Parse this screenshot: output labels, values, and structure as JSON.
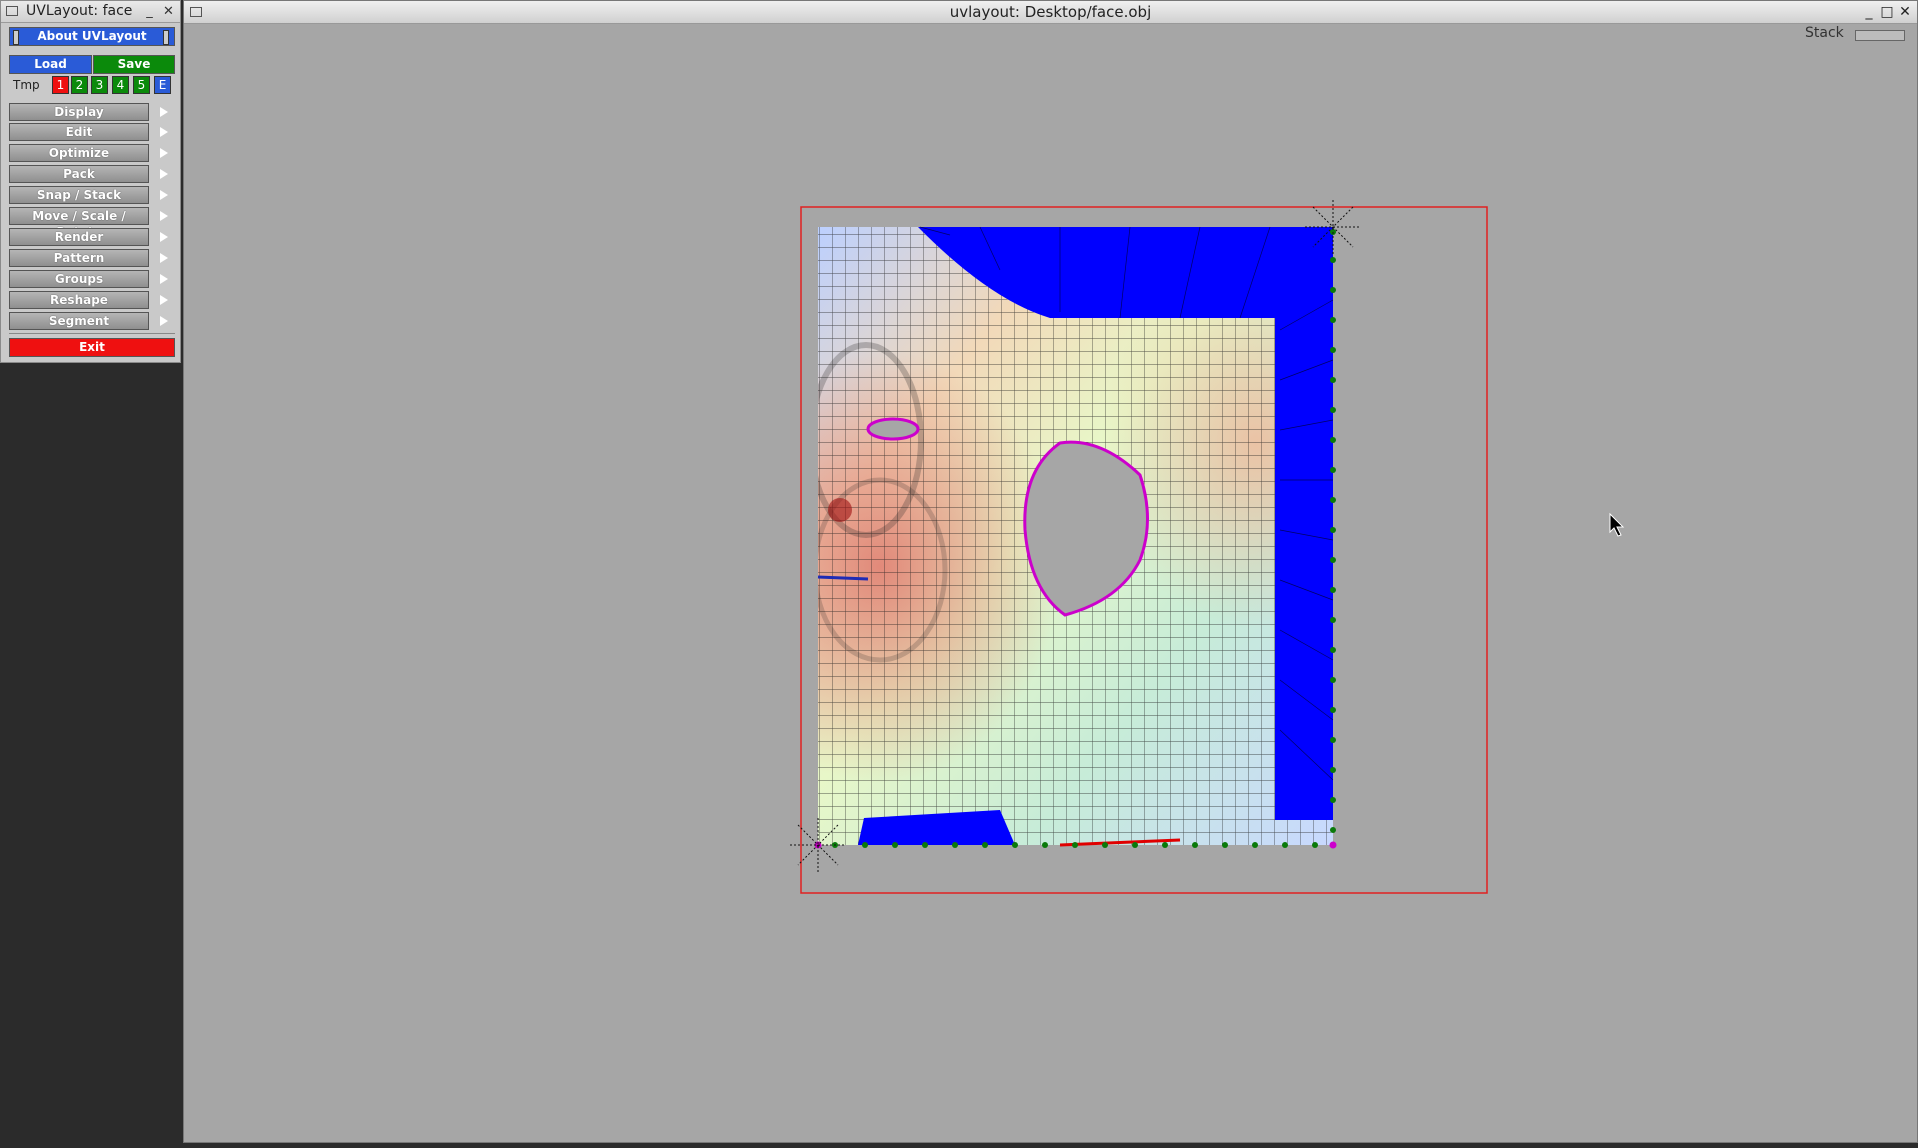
{
  "tool_window": {
    "title": "UVLayout: face",
    "about_label": "About UVLayout",
    "load_label": "Load",
    "save_label": "Save",
    "tmp_label": "Tmp",
    "tmp_slots": [
      "1",
      "2",
      "3",
      "4",
      "5",
      "E"
    ],
    "menu": [
      "Display",
      "Edit",
      "Optimize",
      "Pack",
      "Snap / Stack",
      "Move / Scale / Rotate",
      "Render",
      "Pattern",
      "Groups",
      "Reshape",
      "Segment"
    ],
    "exit_label": "Exit"
  },
  "main_window": {
    "title": "uvlayout: Desktop/face.obj",
    "stack_label": "Stack"
  },
  "colors": {
    "blue_button": "#2a5bd7",
    "green_button": "#0b8a0b",
    "red_button": "#ef1010",
    "viewport_bg": "#a6a6a6",
    "uv_fill_blue": "#0000ff",
    "seam_magenta": "#cc00cc",
    "bounds_red": "#e02020"
  }
}
